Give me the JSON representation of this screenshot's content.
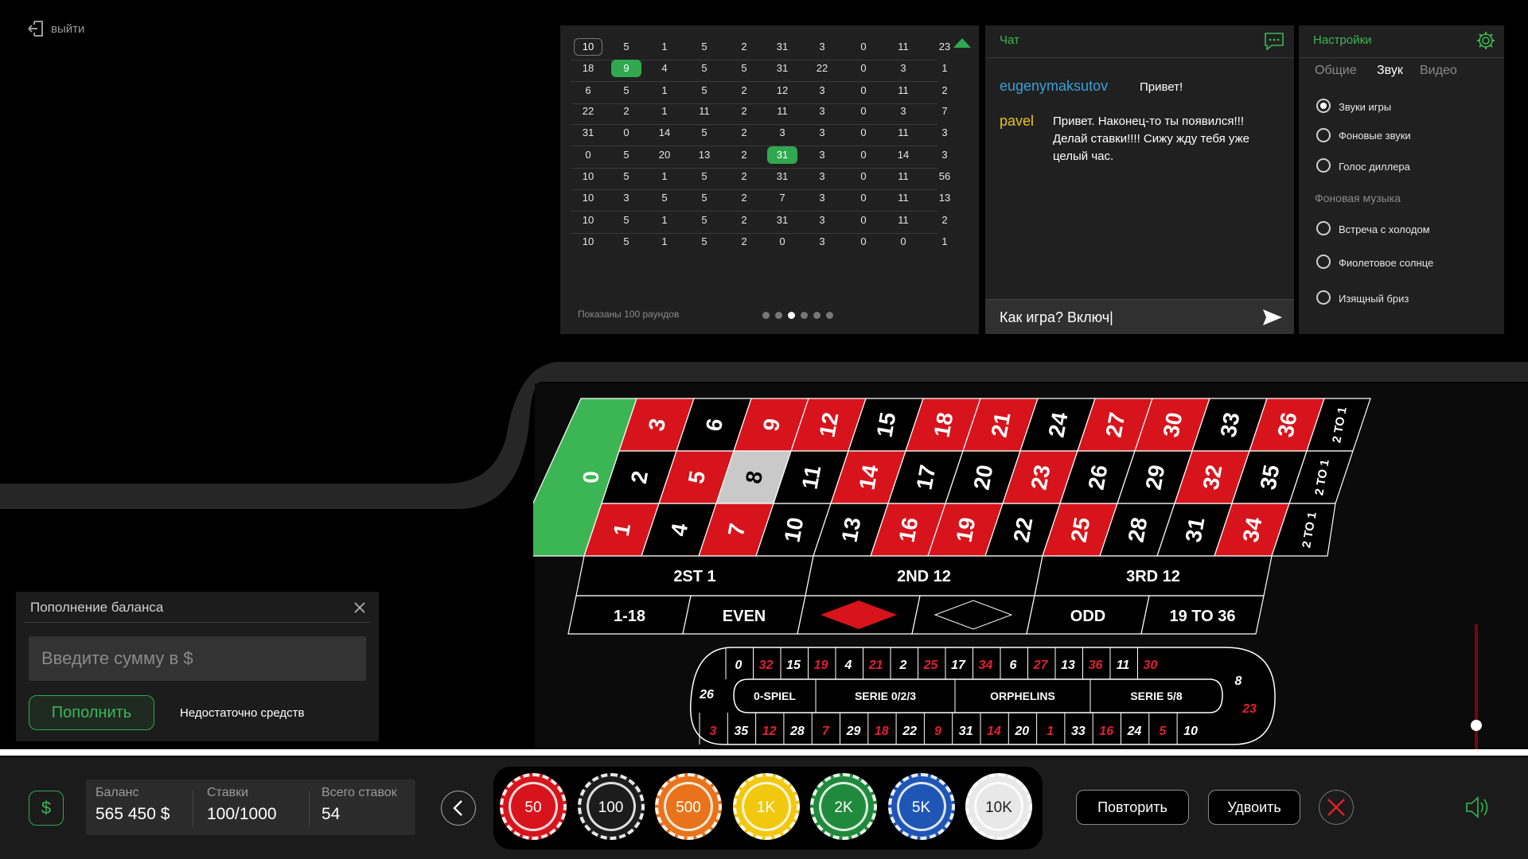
{
  "exit": {
    "label": "выйти"
  },
  "history": {
    "rows": [
      [
        "10",
        "5",
        "1",
        "5",
        "2",
        "31",
        "3",
        "0",
        "11",
        "23"
      ],
      [
        "18",
        "9",
        "4",
        "5",
        "5",
        "31",
        "22",
        "0",
        "3",
        "1"
      ],
      [
        "6",
        "5",
        "1",
        "5",
        "2",
        "12",
        "3",
        "0",
        "11",
        "2"
      ],
      [
        "22",
        "2",
        "1",
        "11",
        "2",
        "11",
        "3",
        "0",
        "3",
        "7"
      ],
      [
        "31",
        "0",
        "14",
        "5",
        "2",
        "3",
        "3",
        "0",
        "11",
        "3"
      ],
      [
        "0",
        "5",
        "20",
        "13",
        "2",
        "31",
        "3",
        "0",
        "14",
        "3"
      ],
      [
        "10",
        "5",
        "1",
        "5",
        "2",
        "31",
        "3",
        "0",
        "11",
        "56"
      ],
      [
        "10",
        "3",
        "5",
        "5",
        "2",
        "7",
        "3",
        "0",
        "11",
        "13"
      ],
      [
        "10",
        "5",
        "1",
        "5",
        "2",
        "31",
        "3",
        "0",
        "11",
        "2"
      ],
      [
        "10",
        "5",
        "1",
        "5",
        "2",
        "0",
        "3",
        "0",
        "0",
        "1"
      ]
    ],
    "footer": "Показаны 100 раундов",
    "pages": 6,
    "active_page": 3
  },
  "chat": {
    "title": "Чат",
    "messages": [
      {
        "user": "eugenymaksutov",
        "text": "Привет!",
        "color": "#3aa0d8"
      },
      {
        "user": "pavel",
        "text": "Привет. Наконец-то ты появился!!! Делай ставки!!!! Сижу жду тебя уже целый час.",
        "color": "#e8c21f"
      }
    ],
    "input_value": "Как игра? Включ|"
  },
  "settings": {
    "title": "Настройки",
    "tabs": [
      "Общие",
      "Звук",
      "Видео"
    ],
    "active_tab": "Звук",
    "sound_options": [
      "Звуки игры",
      "Фоновые звуки",
      "Голос диллера"
    ],
    "music_header": "Фоновая музыка",
    "music_options": [
      "Встреча с холодом",
      "Фиолетовое солнце",
      "Изящный бриз"
    ]
  },
  "table": {
    "zero": "0",
    "columns": [
      [
        "3",
        "2",
        "1"
      ],
      [
        "6",
        "5",
        "4"
      ],
      [
        "9",
        "8",
        "7"
      ],
      [
        "12",
        "11",
        "10"
      ],
      [
        "15",
        "14",
        "13"
      ],
      [
        "18",
        "17",
        "16"
      ],
      [
        "21",
        "20",
        "19"
      ],
      [
        "24",
        "23",
        "22"
      ],
      [
        "27",
        "26",
        "25"
      ],
      [
        "30",
        "29",
        "28"
      ],
      [
        "33",
        "32",
        "31"
      ],
      [
        "36",
        "35",
        "34"
      ]
    ],
    "red_numbers": [
      1,
      3,
      5,
      7,
      9,
      12,
      14,
      16,
      18,
      19,
      21,
      23,
      25,
      27,
      30,
      32,
      34,
      36
    ],
    "highlight": "8",
    "column_bets": [
      "2 TO 1",
      "2 TO 1",
      "2 TO 1"
    ],
    "dozens": [
      "2ST 1",
      "2ND 12",
      "3RD 12"
    ],
    "outside": [
      "1-18",
      "EVEN",
      "",
      "",
      "ODD",
      "19 TO 36"
    ],
    "colors": {
      "red": "#d7141c",
      "black": "#000000",
      "green": "#3cb655",
      "highlight": "#c9c9c9"
    }
  },
  "race": {
    "top": [
      "0",
      "32",
      "15",
      "19",
      "4",
      "21",
      "2",
      "25",
      "17",
      "34",
      "6",
      "27",
      "13",
      "36",
      "11",
      "30"
    ],
    "bottom": [
      "3",
      "35",
      "12",
      "28",
      "7",
      "29",
      "18",
      "22",
      "9",
      "31",
      "14",
      "20",
      "1",
      "33",
      "16",
      "24",
      "5",
      "10"
    ],
    "left": "26",
    "right": [
      "8",
      "23"
    ],
    "sectors": [
      "0-SPIEL",
      "SERIE 0/2/3",
      "ORPHELINS",
      "SERIE 5/8"
    ]
  },
  "deposit": {
    "title": "Пополнение баланса",
    "placeholder": "Введите сумму в $",
    "button": "Пополнить",
    "note": "Недостаточно средств"
  },
  "bottom": {
    "balance_label": "Баланс",
    "balance_value": "565 450 $",
    "bets_label": "Ставки",
    "bets_value": "100/1000",
    "total_label": "Всего ставок",
    "total_value": "54",
    "chips": [
      {
        "label": "50",
        "color": "#d7141c"
      },
      {
        "label": "100",
        "color": "#1c1c1c"
      },
      {
        "label": "500",
        "color": "#e8731a"
      },
      {
        "label": "1K",
        "color": "#f2c80f"
      },
      {
        "label": "2K",
        "color": "#1f8a3b"
      },
      {
        "label": "5K",
        "color": "#1f55b5"
      },
      {
        "label": "10K",
        "color": "#e8e8e8"
      }
    ],
    "repeat": "Повторить",
    "double": "Удвоить"
  }
}
